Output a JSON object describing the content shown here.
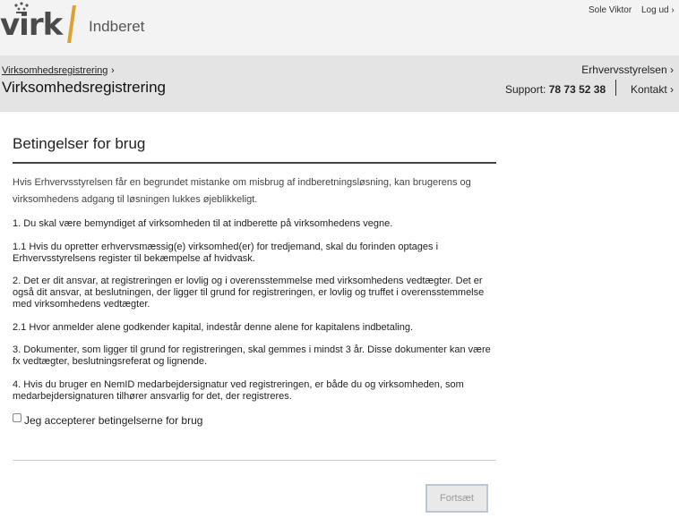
{
  "header": {
    "logo_text": "virk",
    "app_name": "Indberet",
    "user_name": "Sole Viktor",
    "logout_label": "Log ud ›"
  },
  "subheader": {
    "breadcrumb": "Virksomhedsregistrering",
    "breadcrumb_arrow": "›",
    "page_title": "Virksomhedsregistrering",
    "authority": "Erhvervsstyrelsen ›",
    "support_label": "Support:",
    "support_phone": "78 73 52 38",
    "contact": "Kontakt ›"
  },
  "terms": {
    "title": "Betingelser for brug",
    "intro": "Hvis Erhvervsstyrelsen får en begrundet mistanke om misbrug af indberetningsløsning, kan brugerens og virksomhedens adgang til løsningen lukkes øjeblikkeligt.",
    "items": [
      "1. Du skal være bemyndiget af virksomheden til at indberette på virksomhedens vegne.",
      "1.1 Hvis du opretter erhvervsmæssig(e) virksomhed(er) for tredjemand, skal du forinden optages i Erhvervsstyrelsens register til bekæmpelse af hvidvask.",
      "2. Det er dit ansvar, at registreringen er lovlig og i overensstemmelse med virksomhedens vedtægter. Det er også dit ansvar, at beslutningen, der ligger til grund for registreringen, er lovlig og truffet i overensstemmelse med virksomhedens vedtægter.",
      "2.1 Hvor anmelder alene godkender kapital, indestår denne alene for kapitalens indbetaling.",
      "3. Dokumenter, som ligger til grund for registreringen, skal gemmes i mindst 3 år. Disse dokumenter kan være fx vedtægter, beslutningsreferat og lignende.",
      "4. Hvis du bruger en NemID medarbejdersignatur ved registreringen, er både du og virksomheden, som medarbejdersignaturen tilhører ansvarlig for det, der registreres."
    ],
    "accept_label": "Jeg accepterer betingelserne for brug",
    "accept_checked": false,
    "continue_label": "Fortsæt"
  },
  "colors": {
    "accent_divider": "#e0a030",
    "header_bg": "#f3f3f3",
    "subheader_bg": "#e4e4e4"
  }
}
